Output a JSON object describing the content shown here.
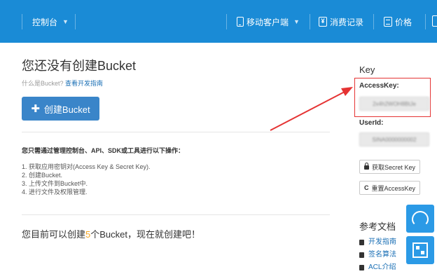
{
  "topbar": {
    "console_label": "控制台",
    "mobile_label": "移动客户端",
    "billing_label": "消费记录",
    "price_label": "价格"
  },
  "main": {
    "title": "您还没有创建Bucket",
    "what_is": "什么是Bucket?",
    "dev_guide_link": "查看开发指南",
    "create_button": "创建Bucket",
    "ops_heading": "您只需通过管理控制台、API、SDK或工具进行以下操作：",
    "steps": [
      "1. 获取应用密钥对(Access Key & Secret Key).",
      "2. 创建Bucket.",
      "3. 上传文件到Bucket中.",
      "4. 进行文件及权限管理."
    ],
    "cta_prefix": "您目前可以创建",
    "cta_count": "5",
    "cta_suffix": "个Bucket，现在就创建吧！"
  },
  "key_panel": {
    "title": "Key",
    "access_key_label": "AccessKey:",
    "access_key_value": "2x4h2WOH8BtJe",
    "userid_label": "UserId:",
    "userid_value": "SINA0000000002",
    "get_secret_button": "获取Secret Key",
    "reset_access_button": "重置AccessKey"
  },
  "references": {
    "title": "参考文档",
    "items": [
      "开发指南",
      "签名算法",
      "ACL介绍"
    ]
  },
  "colors": {
    "topbar": "#1a8bd6",
    "primary_button": "#3a85c9",
    "highlight_box": "#e53333",
    "count_accent": "#f5a623",
    "link": "#1a6fb5"
  }
}
